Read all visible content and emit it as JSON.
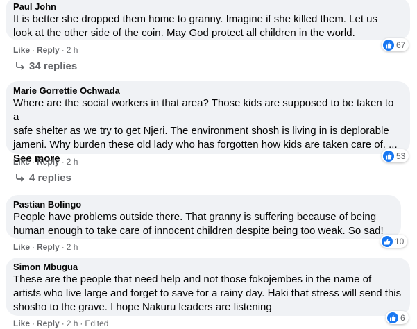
{
  "comments": [
    {
      "author": "Paul John",
      "text": [
        "It is better she dropped them home to granny. Imagine if she killed them. Let us",
        "look at the other side of the coin. May God protect all children in the world."
      ],
      "see_more": "",
      "like": "Like",
      "reply": "Reply",
      "time": "2 h",
      "edited": "",
      "reactions": "67",
      "replies": "34 replies"
    },
    {
      "author": "Marie Gorrettie Ochwada",
      "text": [
        "Where are the social workers in that area? Those kids are supposed to be taken to a",
        "safe shelter as we try to get Njeri. The environment shosh is living in is deplorable",
        "jameni. Why burden these old lady who has forgotten how kids are taken care of. ..."
      ],
      "see_more": "See more",
      "like": "Like",
      "reply": "Reply",
      "time": "2 h",
      "edited": "",
      "reactions": "53",
      "replies": "4 replies"
    },
    {
      "author": "Pastian Bolingo",
      "text": [
        "People have problems outside there. That granny is suffering because of being",
        "human enough to take care of innocent children despite being too weak. So sad!"
      ],
      "see_more": "",
      "like": "Like",
      "reply": "Reply",
      "time": "2 h",
      "edited": "",
      "reactions": "10",
      "replies": ""
    },
    {
      "author": "Simon Mbugua",
      "text": [
        "These are the people that need help and not those fokojembes in the name of",
        "artists who live large and forget to save for a rainy day. Haki that stress will send this",
        "shosho to the grave. I hope Nakuru leaders are listening"
      ],
      "see_more": "",
      "like": "Like",
      "reply": "Reply",
      "time": "2 h",
      "edited": "Edited",
      "reactions": "6",
      "replies": ""
    }
  ],
  "colors": {
    "bubble": "#f0f2f5",
    "meta": "#65676b",
    "like_blue": "#1877f2"
  }
}
